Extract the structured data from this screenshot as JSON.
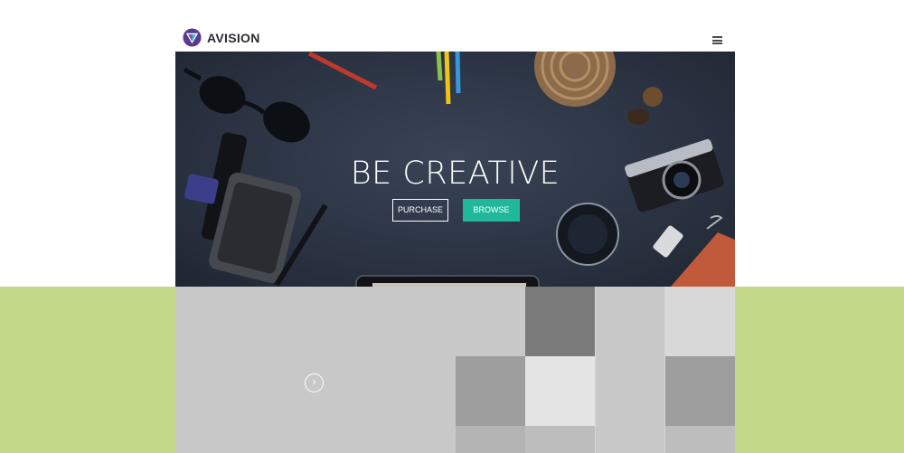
{
  "brand": {
    "name": "AVISION",
    "logo_icon": "triangle-gem-logo"
  },
  "header": {
    "menu_icon": "hamburger-menu-icon"
  },
  "hero": {
    "title": "BE CREATIVE",
    "purchase_label": "PURCHASE",
    "browse_label": "BROWSE"
  },
  "slider": {
    "next_icon": "chevron-right-icon",
    "next_glyph": "›"
  },
  "colors": {
    "accent": "#1fb89a",
    "band": "#c3d98a",
    "hero_bg": "#2c3444",
    "tile_light": "#c8c8c8",
    "tile_mid": "#9e9e9e",
    "tile_dark": "#7a7a7a",
    "tile_pale": "#e4e4e4"
  }
}
